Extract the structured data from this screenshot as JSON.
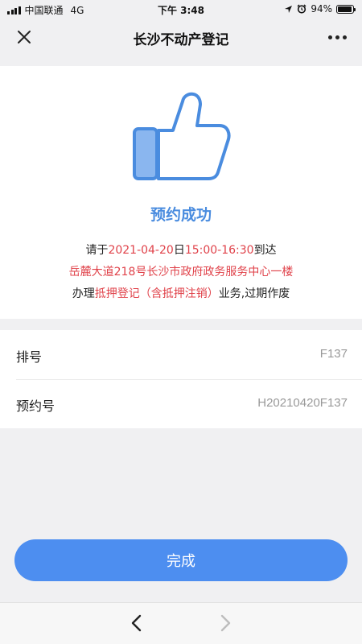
{
  "status_bar": {
    "carrier": "中国联通",
    "network": "4G",
    "time": "下午 3:48",
    "battery": "94%",
    "battery_level": 0.94
  },
  "nav": {
    "title": "长沙不动产登记",
    "close_icon": "close-icon",
    "more_icon": "more-icon"
  },
  "success": {
    "icon": "thumbs-up-icon",
    "title": "预约成功",
    "line1": {
      "prefix": "请于",
      "date": "2021-04-20",
      "day_suffix": "日",
      "time_range": "15:00-16:30",
      "suffix": "到达"
    },
    "line2": "岳麓大道218号长沙市政府政务服务中心一楼",
    "line3": {
      "prefix": "办理",
      "business": "抵押登记（含抵押注销）",
      "suffix": "业务,过期作废"
    }
  },
  "details": [
    {
      "label": "排号",
      "value": "F137"
    },
    {
      "label": "预约号",
      "value": "H20210420F137"
    }
  ],
  "button": {
    "label": "完成"
  },
  "colors": {
    "accent_blue": "#4a8cdf",
    "button_blue": "#4d8ef0",
    "highlight_red": "#e0424a"
  }
}
